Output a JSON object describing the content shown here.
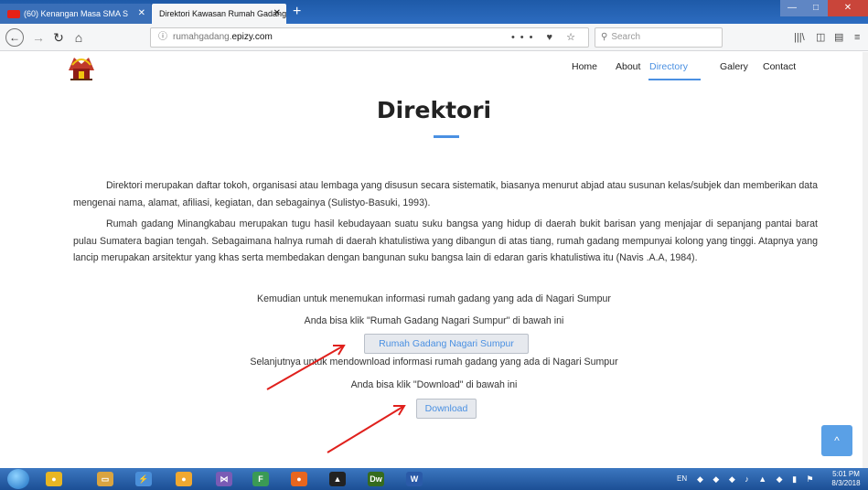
{
  "browser": {
    "tabs": [
      {
        "label": "(60) Kenangan Masa SMA S"
      },
      {
        "label": "Direktori Kawasan Rumah Gadang"
      }
    ],
    "new_tab": "+",
    "url": {
      "prefix": "rumahgadang.",
      "domain": "epizy.com"
    },
    "url_icons": "••• ♥ ☆",
    "search_placeholder": "Search"
  },
  "site": {
    "nav": [
      "Home",
      "About",
      "Directory",
      "Galery",
      "Contact"
    ],
    "active_nav": "Directory",
    "title": "Direktori",
    "paragraphs": [
      "Direktori merupakan daftar tokoh, organisasi atau lembaga yang disusun secara sistematik, biasanya menurut abjad atau susunan kelas/subjek dan memberikan data mengenai nama, alamat, afiliasi, kegiatan, dan sebagainya (Sulistyo-Basuki, 1993).",
      "Rumah gadang Minangkabau merupakan tugu hasil kebudayaan suatu suku bangsa yang hidup di daerah bukit barisan yang menjajar di sepanjang pantai barat pulau Sumatera bagian tengah. Sebagaimana halnya rumah di daerah khatulistiwa yang dibangun di atas tiang, rumah gadang mempunyai kolong yang tinggi. Atapnya yang lancip merupakan arsitektur yang khas serta membedakan dengan bangunan suku bangsa lain di edaran garis khatulistiwa itu (Navis .A.A, 1984)."
    ],
    "centered_lines": [
      "Kemudian untuk menemukan informasi rumah gadang yang ada di Nagari Sumpur",
      "Anda bisa klik \"Rumah Gadang Nagari Sumpur\" di bawah ini",
      "Selanjutnya untuk mendownload informasi rumah gadang yang ada di Nagari Sumpur",
      "Anda bisa klik \"Download\" di bawah ini"
    ],
    "buttons": {
      "sumpur": "Rumah Gadang Nagari Sumpur",
      "download": "Download"
    },
    "scroll_top_icon": "^"
  },
  "taskbar": {
    "lang": "EN",
    "time": "5:01 PM",
    "date": "8/3/2018",
    "apps": [
      "chrome",
      "explorer",
      "winamp",
      "outlook",
      "firefox",
      "adobe",
      "dreamweaver",
      "word"
    ]
  },
  "colors": {
    "accent": "#4a90e2",
    "title": "#222222",
    "annotation_arrow": "#e0201c"
  }
}
